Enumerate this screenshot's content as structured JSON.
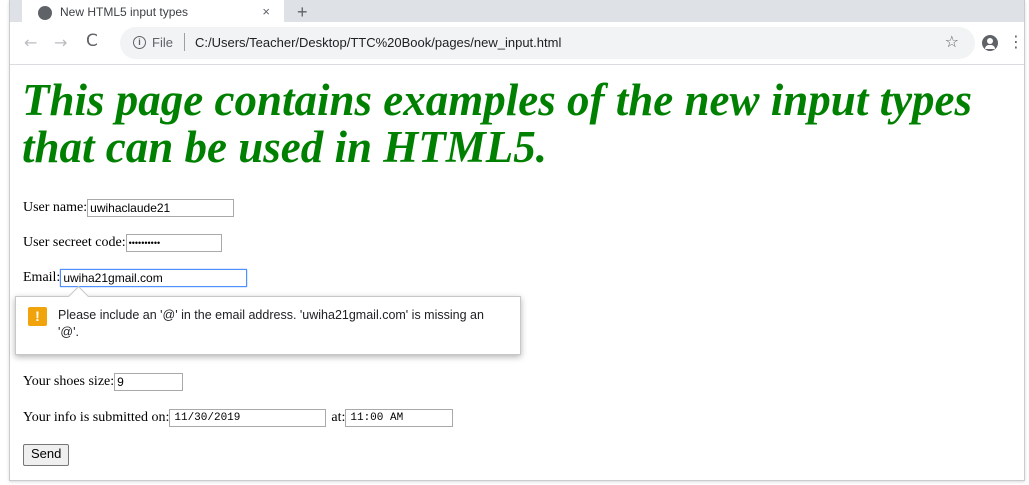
{
  "browser": {
    "tab_title": "New HTML5 input types",
    "tab_close": "×",
    "new_tab": "+",
    "back": "←",
    "forward": "→",
    "reload": "C",
    "info_glyph": "i",
    "file_label": "File",
    "url": "C:/Users/Teacher/Desktop/TTC%20Book/pages/new_input.html",
    "star": "☆",
    "menu": "⋮"
  },
  "page": {
    "heading": "This page contains examples of the new input types that can be used in HTML5.",
    "fields": {
      "username": {
        "label": "User name:",
        "value": "uwihaclaude21"
      },
      "secret": {
        "label": "User secreet code:",
        "value": "••••••••••"
      },
      "email": {
        "label": "Email:",
        "value": "uwiha21gmail.com"
      },
      "shoes": {
        "label": "Your shoes size:",
        "value": "9"
      },
      "submitted_date": {
        "label": "Your info is submitted on:",
        "value": "11/30/2019"
      },
      "submitted_time": {
        "label": "at:",
        "value": "11:00 AM"
      }
    },
    "send_label": "Send"
  },
  "validation": {
    "icon": "!",
    "message": "Please include an '@' in the email address. 'uwiha21gmail.com' is missing an '@'."
  },
  "colors": {
    "heading": "#008000",
    "warning": "#f0a30a",
    "focus": "#4d90fe"
  }
}
